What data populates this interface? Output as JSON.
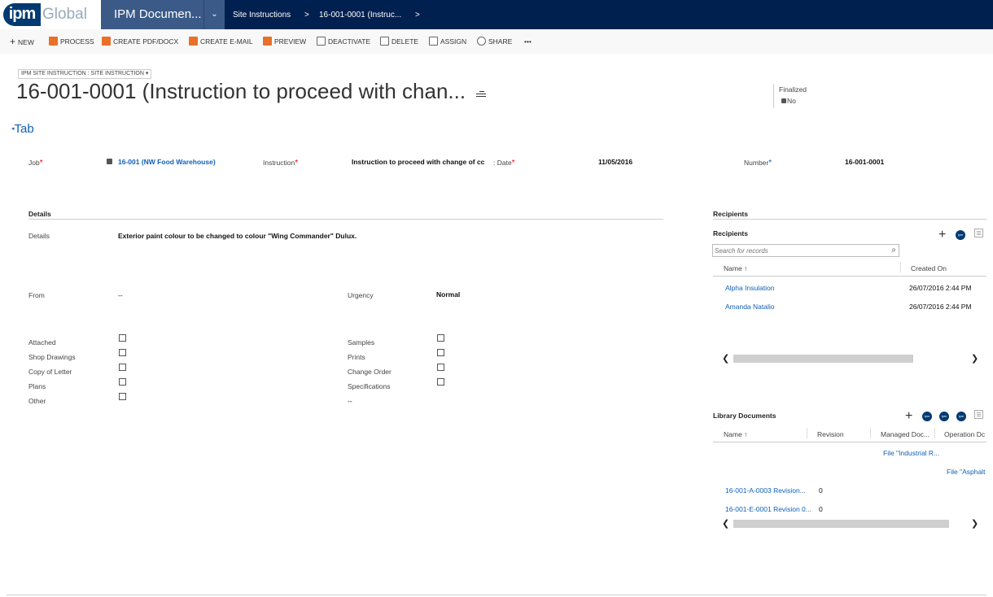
{
  "nav": {
    "logo_prefix": "ipm",
    "logo_suffix": "Global",
    "area": "IPM Documen...",
    "chevron": "⌄",
    "crumb1": "Site Instructions",
    "sep": ">",
    "crumb2": "16-001-0001 (Instruc...",
    "sep2": ">"
  },
  "commands": {
    "new": "NEW",
    "process": "PROCESS",
    "create_pdf": "CREATE PDF/DOCX",
    "create_email": "CREATE E-MAIL",
    "preview": "PREVIEW",
    "deactivate": "DEACTIVATE",
    "delete": "DELETE",
    "assign": "ASSIGN",
    "share": "SHARE",
    "more": "•••"
  },
  "header": {
    "entity_selector": "IPM SITE INSTRUCTION : SITE INSTRUCTION ▾",
    "title": "16-001-0001 (Instruction to proceed with chan...",
    "finalized_label": "Finalized",
    "finalized_value": "No"
  },
  "tab": {
    "label": "Tab"
  },
  "summary": {
    "job_label": "Job",
    "job_value": "16-001 (NW Food Warehouse)",
    "instruction_label": "Instruction",
    "instruction_value": "Instruction to proceed with change of cc",
    "date_label": ": Date",
    "date_value": "11/05/2016",
    "number_label": "Number",
    "number_value": "16-001-0001",
    "req": "*"
  },
  "details": {
    "section_title": "Details",
    "details_label": "Details",
    "details_value": "Exterior paint colour to be changed to colour \"Wing Commander\" Dulux.",
    "from_label": "From",
    "from_value": "--",
    "urgency_label": "Urgency",
    "urgency_value": "Normal",
    "left_checks": [
      "Attached",
      "Shop Drawings",
      "Copy of Letter",
      "Plans",
      "Other"
    ],
    "right_checks": [
      "Samples",
      "Prints",
      "Change Order",
      "Specifications"
    ],
    "right_after": "--"
  },
  "recipients": {
    "section_title": "Recipients",
    "grid_title": "Recipients",
    "search_placeholder": "Search for records",
    "col_name": "Name ↑",
    "col_created": "Created On",
    "rows": [
      {
        "name": "Alpha Insulation",
        "created": "26/07/2016 2:44 PM"
      },
      {
        "name": "Amanda Natalio",
        "created": "26/07/2016 2:44 PM"
      }
    ]
  },
  "library": {
    "grid_title": "Library Documents",
    "col_name": "Name ↑",
    "col_revision": "Revision",
    "col_managed": "Managed Doc...",
    "col_operation": "Operation Dc",
    "file1": "File \"Industrial R...",
    "file2": "File \"Asphalt",
    "rows": [
      {
        "name": "16-001-A-0003 Revision...",
        "revision": "0"
      },
      {
        "name": "16-001-E-0001 Revision 0...",
        "revision": "0"
      }
    ]
  },
  "icons": {
    "badge": "ipm",
    "plus": "+",
    "search": "⌕",
    "left_arrow": "❮",
    "right_arrow": "❯",
    "lock": "🔒"
  },
  "colors": {
    "nav_bg": "#002050",
    "area_bg": "#3b5a87",
    "link": "#1160b7",
    "command_icon": "#e8712a"
  }
}
